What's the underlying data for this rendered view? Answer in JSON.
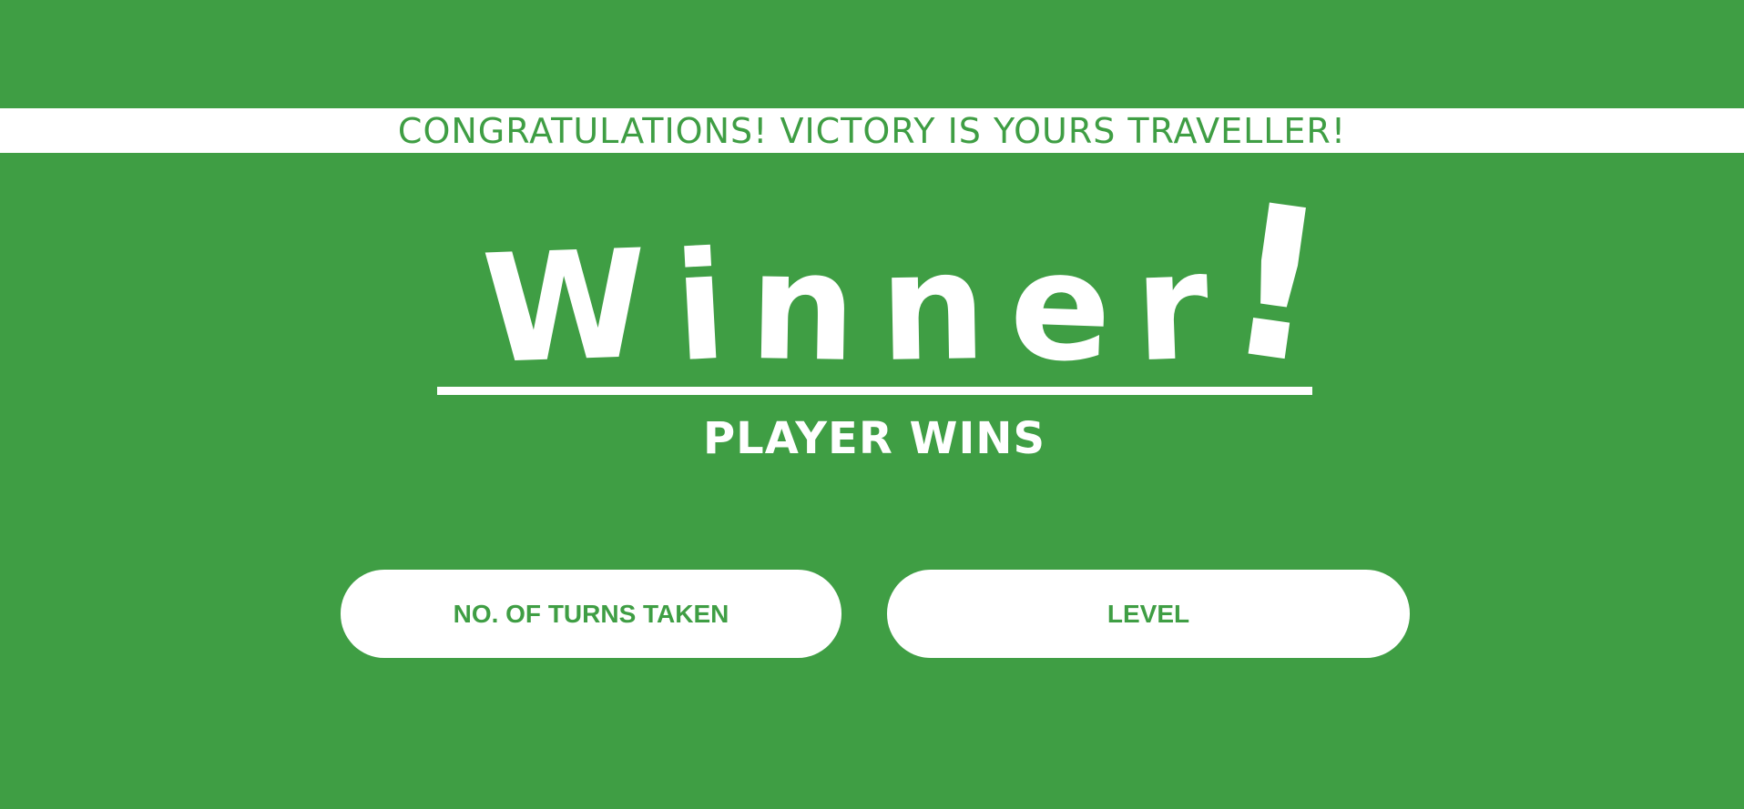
{
  "colors": {
    "background": "#3f9e44",
    "foreground": "#ffffff"
  },
  "banner": {
    "text": "CONGRATULATIONS! VICTORY IS YOURS TRAVELLER!"
  },
  "title": {
    "text": "Winner!",
    "letters": [
      "W",
      "i",
      "n",
      "n",
      "e",
      "r",
      "!"
    ]
  },
  "result": {
    "text": "PLAYER WINS"
  },
  "stats": {
    "turns_label": "NO. OF TURNS TAKEN",
    "level_label": "LEVEL"
  }
}
